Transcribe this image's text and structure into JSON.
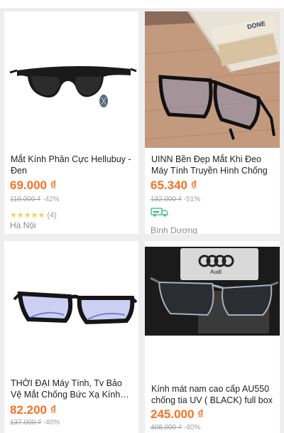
{
  "colors": {
    "price": "#f57224",
    "star": "#faca51",
    "freeship": "#2bb673"
  },
  "products": [
    {
      "title": "Mắt Kính Phân Cực Hellubuy - Đen",
      "price": "69.000 ₫",
      "old_price": "119.000 ₫",
      "discount": "-42%",
      "rating_stars": "★★★★★",
      "rating_count": "(4)",
      "location": "Hà Nội",
      "image_icon": "sunglasses-black-polarized"
    },
    {
      "title": "UINN Bền Đẹp Mắt Khi Đeo Máy Tính Truyền Hình Chống",
      "price": "65.340 ₫",
      "old_price": "132.000 ₫",
      "discount": "-51%",
      "free_shipping_icon": "free-shipping-truck-icon",
      "location": "Bình Dương",
      "image_icon": "computer-glasses-on-desk"
    },
    {
      "title": "THỜI ĐẠI Máy Tính, Tv Bảo Vệ Mắt Chống Bức Xạ Kính Bảo Vệ",
      "price": "82.200 ₫",
      "old_price": "137.000 ₫",
      "discount": "-40%",
      "image_icon": "blue-light-glasses"
    },
    {
      "title": "Kính mát nam cao cấp AU550 chống tia UV ( BLACK) full box",
      "price": "245.000 ₫",
      "old_price": "408.000 ₫",
      "discount": "-40%",
      "image_icon": "sunglasses-with-box"
    }
  ],
  "packaging_text": {
    "book_text": "DONE",
    "case_brand": "Audi"
  }
}
